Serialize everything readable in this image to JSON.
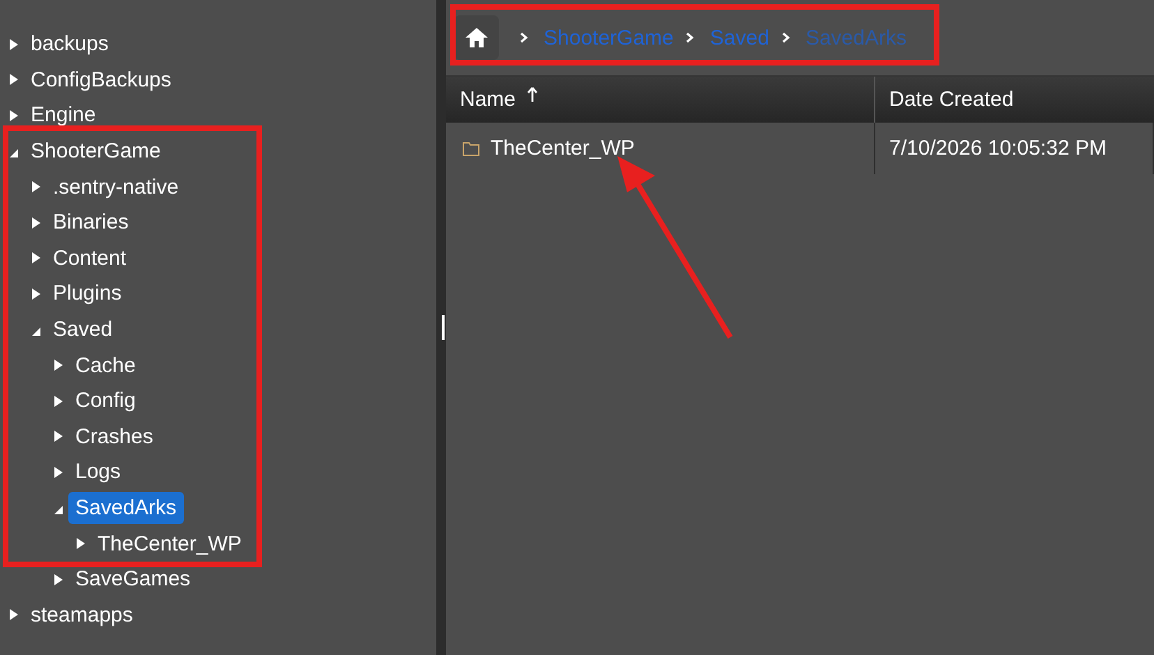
{
  "tree": [
    {
      "label": "backups",
      "expanded": false,
      "selected": false
    },
    {
      "label": "ConfigBackups",
      "expanded": false,
      "selected": false
    },
    {
      "label": "Engine",
      "expanded": false,
      "selected": false
    },
    {
      "label": "ShooterGame",
      "expanded": true,
      "selected": false,
      "children": [
        {
          "label": ".sentry-native",
          "expanded": false,
          "selected": false
        },
        {
          "label": "Binaries",
          "expanded": false,
          "selected": false
        },
        {
          "label": "Content",
          "expanded": false,
          "selected": false
        },
        {
          "label": "Plugins",
          "expanded": false,
          "selected": false
        },
        {
          "label": "Saved",
          "expanded": true,
          "selected": false,
          "children": [
            {
              "label": "Cache",
              "expanded": false,
              "selected": false
            },
            {
              "label": "Config",
              "expanded": false,
              "selected": false
            },
            {
              "label": "Crashes",
              "expanded": false,
              "selected": false
            },
            {
              "label": "Logs",
              "expanded": false,
              "selected": false
            },
            {
              "label": "SavedArks",
              "expanded": true,
              "selected": true,
              "children": [
                {
                  "label": "TheCenter_WP",
                  "expanded": false,
                  "selected": false
                }
              ]
            },
            {
              "label": "SaveGames",
              "expanded": false,
              "selected": false
            }
          ]
        }
      ]
    },
    {
      "label": "steamapps",
      "expanded": false,
      "selected": false
    }
  ],
  "breadcrumb": [
    {
      "label": "ShooterGame",
      "current": false
    },
    {
      "label": "Saved",
      "current": false
    },
    {
      "label": "SavedArks",
      "current": true
    }
  ],
  "table": {
    "columns": [
      {
        "label": "Name",
        "sorted": true
      },
      {
        "label": "Date Created",
        "sorted": false
      }
    ],
    "rows": [
      {
        "name": "TheCenter_WP",
        "date_created": "7/10/2026 10:05:32 PM"
      }
    ]
  },
  "annotations": [
    {
      "kind": "frame"
    },
    {
      "kind": "frame"
    },
    {
      "kind": "arrow"
    }
  ]
}
